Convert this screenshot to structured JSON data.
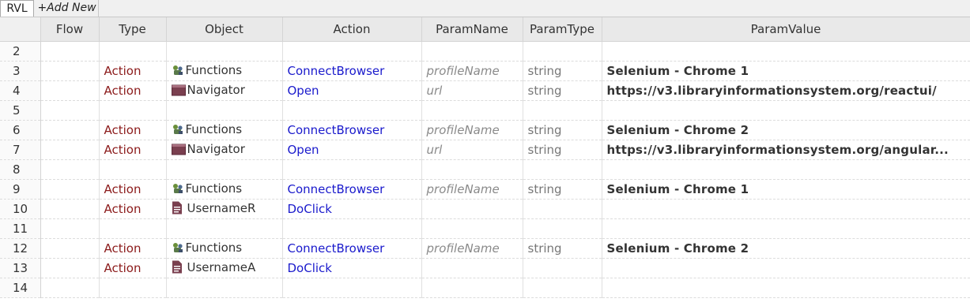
{
  "tabs": {
    "rvl": "RVL",
    "add_new": "+Add New"
  },
  "columns": [
    "Flow",
    "Type",
    "Object",
    "Action",
    "ParamName",
    "ParamType",
    "ParamValue"
  ],
  "rows": [
    {
      "num": "2",
      "flow": "",
      "type": "",
      "object_icon": "",
      "object": "",
      "action": "",
      "param_name": "",
      "param_type": "",
      "param_value": ""
    },
    {
      "num": "3",
      "flow": "",
      "type": "Action",
      "object_icon": "functions-icon",
      "object": "Functions",
      "action": "ConnectBrowser",
      "param_name": "profileName",
      "param_type": "string",
      "param_value": "Selenium - Chrome 1"
    },
    {
      "num": "4",
      "flow": "",
      "type": "Action",
      "object_icon": "navigator-icon",
      "object": "Navigator",
      "action": "Open",
      "param_name": "url",
      "param_type": "string",
      "param_value": "https://v3.libraryinformationsystem.org/reactui/"
    },
    {
      "num": "5",
      "flow": "",
      "type": "",
      "object_icon": "",
      "object": "",
      "action": "",
      "param_name": "",
      "param_type": "",
      "param_value": ""
    },
    {
      "num": "6",
      "flow": "",
      "type": "Action",
      "object_icon": "functions-icon",
      "object": "Functions",
      "action": "ConnectBrowser",
      "param_name": "profileName",
      "param_type": "string",
      "param_value": "Selenium - Chrome 2"
    },
    {
      "num": "7",
      "flow": "",
      "type": "Action",
      "object_icon": "navigator-icon",
      "object": "Navigator",
      "action": "Open",
      "param_name": "url",
      "param_type": "string",
      "param_value": "https://v3.libraryinformationsystem.org/angular..."
    },
    {
      "num": "8",
      "flow": "",
      "type": "",
      "object_icon": "",
      "object": "",
      "action": "",
      "param_name": "",
      "param_type": "",
      "param_value": ""
    },
    {
      "num": "9",
      "flow": "",
      "type": "Action",
      "object_icon": "functions-icon",
      "object": "Functions",
      "action": "ConnectBrowser",
      "param_name": "profileName",
      "param_type": "string",
      "param_value": "Selenium - Chrome 1"
    },
    {
      "num": "10",
      "flow": "",
      "type": "Action",
      "object_icon": "document-icon",
      "object": "UsernameR",
      "action": "DoClick",
      "param_name": "",
      "param_type": "",
      "param_value": ""
    },
    {
      "num": "11",
      "flow": "",
      "type": "",
      "object_icon": "",
      "object": "",
      "action": "",
      "param_name": "",
      "param_type": "",
      "param_value": ""
    },
    {
      "num": "12",
      "flow": "",
      "type": "Action",
      "object_icon": "functions-icon",
      "object": "Functions",
      "action": "ConnectBrowser",
      "param_name": "profileName",
      "param_type": "string",
      "param_value": "Selenium - Chrome 2"
    },
    {
      "num": "13",
      "flow": "",
      "type": "Action",
      "object_icon": "document-icon",
      "object": "UsernameA",
      "action": "DoClick",
      "param_name": "",
      "param_type": "",
      "param_value": ""
    },
    {
      "num": "14",
      "flow": "",
      "type": "",
      "object_icon": "",
      "object": "",
      "action": "",
      "param_name": "",
      "param_type": "",
      "param_value": ""
    }
  ],
  "colors": {
    "type": "#8b1a1a",
    "action": "#1a1acc",
    "header_bg": "#e9e9e9"
  }
}
